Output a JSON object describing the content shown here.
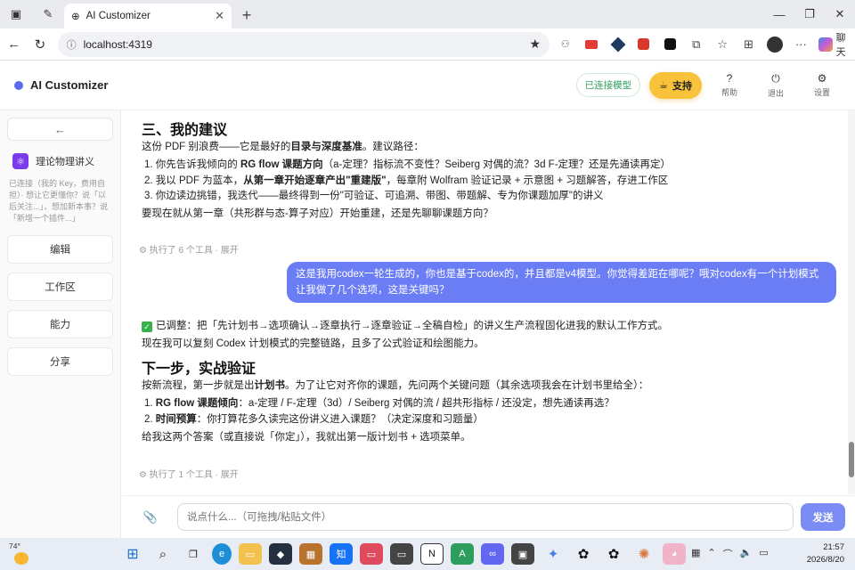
{
  "browser": {
    "tab_title": "AI Customizer",
    "url": "localhost:4319",
    "chat_extension_label": "聊天"
  },
  "header": {
    "app_name": "AI Customizer",
    "connected_label": "已连接模型",
    "support_label": "支持",
    "help_label": "帮助",
    "logout_label": "退出",
    "settings_label": "设置"
  },
  "sidebar": {
    "back_symbol": "←",
    "project_name": "理论物理讲义",
    "note": "已连接（我的 Key，费用自担）· 想让它更懂你？说「以后关注...」，想加新本事？说「新增一个插件...」",
    "buttons": [
      "编辑",
      "工作区",
      "能力",
      "分享"
    ]
  },
  "conversation": {
    "section1_title": "三、我的建议",
    "section1_intro_a": "这份 PDF 别浪费——它是最好的",
    "section1_intro_b": "目录与深度基准",
    "section1_intro_c": "。建议路径：",
    "s1_item1_a": "1. 你先告诉我倾向的 ",
    "s1_item1_b": "RG flow 课题方向",
    "s1_item1_c": "（a-定理？指标流不变性？Seiberg 对偶的流？3d F-定理？还是先通读再定）",
    "s1_item2_a": "2. 我以 PDF 为蓝本，",
    "s1_item2_b": "从第一章开始逐章产出\"重建版\"",
    "s1_item2_c": "，每章附 Wolfram 验证记录 + 示意图 + 习题解答，存进工作区",
    "s1_item3": "3. 你边读边挑错，我迭代——最终得到一份\"可验证、可追溯、带图、带题解、专为你课题加厚\"的讲义",
    "section1_question": "要现在就从第一章（共形群与态-算子对应）开始重建，还是先聊聊课题方向？",
    "tools_run_1": "执行了 6 个工具 · 展开",
    "user_message": "这是我用codex一轮生成的，你也是基于codex的，并且都是v4模型。你觉得差距在哪呢？哦对codex有一个计划模式让我做了几个选项，这是关键吗？",
    "adjusted_check": "✓",
    "adjusted_text": "已调整：把「先计划书→选项确认→逐章执行→逐章验证→全稿自检」的讲义生产流程固化进我的默认工作方式。",
    "adjusted_followup": "现在我可以复刻 Codex 计划模式的完整链路，且多了公式验证和绘图能力。",
    "section2_title": "下一步，实战验证",
    "section2_intro_a": "按新流程，第一步就是出",
    "section2_intro_b": "计划书",
    "section2_intro_c": "。为了让它对齐你的课题，先问两个关键问题（其余选项我会在计划书里给全）：",
    "s2_item1_a": "1. ",
    "s2_item1_b": "RG flow 课题倾向",
    "s2_item1_c": "：a-定理 / F-定理（3d）/ Seiberg 对偶的流 / 超共形指标 / 还没定，想先通读再选？",
    "s2_item2_a": "2. ",
    "s2_item2_b": "时间预算",
    "s2_item2_c": "：你打算花多久读完这份讲义进入课题？（决定深度和习题量）",
    "section2_close": "给我这两个答案（或直接说「你定」），我就出第一版计划书 + 选项菜单。",
    "tools_run_2": "执行了 1 个工具 · 展开"
  },
  "composer": {
    "placeholder": "说点什么...（可拖拽/粘贴文件）",
    "send_label": "发送"
  },
  "taskbar": {
    "weather_temp": "74°",
    "time": "21:57",
    "date": "2026/8/20"
  },
  "colors": {
    "accent": "#6a7df4",
    "support": "#f8c23a",
    "connected": "#2f9e5a"
  }
}
